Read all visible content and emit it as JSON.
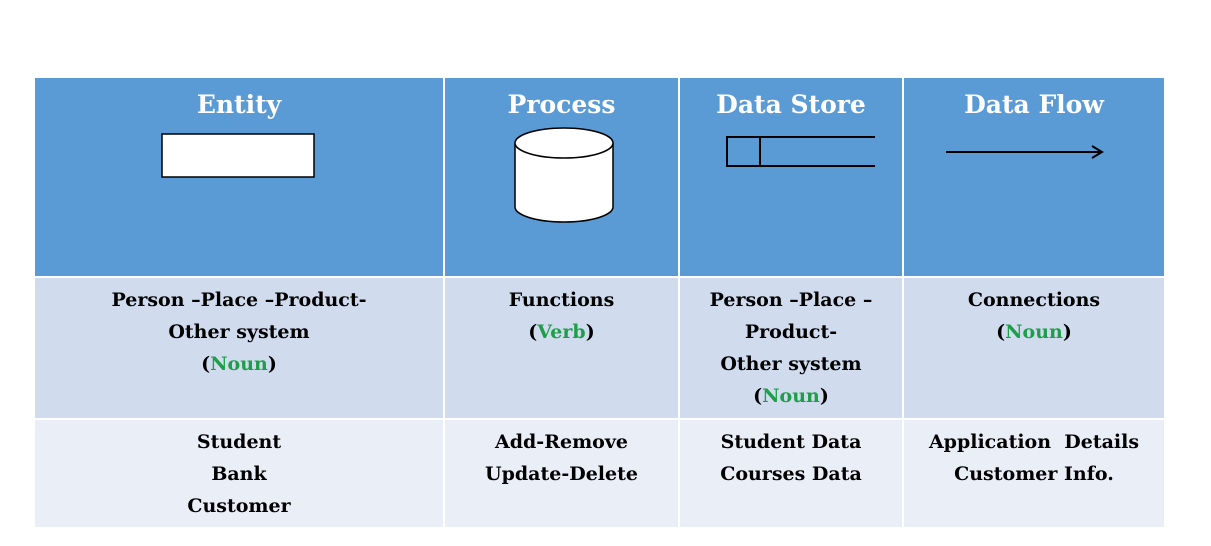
{
  "headers": {
    "entity": "Entity",
    "process": "Process",
    "data_store": "Data Store",
    "data_flow": "Data Flow"
  },
  "descriptions": {
    "entity": {
      "lines": [
        "Person –Place –Product-",
        "Other system"
      ],
      "open": "(",
      "highlight": "Noun",
      "close": ")"
    },
    "process": {
      "lines": [
        "Functions"
      ],
      "open": "(",
      "highlight": "Verb",
      "close": ")"
    },
    "data_store": {
      "lines": [
        "Person –Place –",
        "Product-",
        "Other system"
      ],
      "open": "(",
      "highlight": "Noun",
      "close": ")"
    },
    "data_flow": {
      "lines": [
        "Connections"
      ],
      "open": "(",
      "highlight": "Noun",
      "close": ")"
    }
  },
  "examples": {
    "entity": [
      "Student",
      "Bank",
      "Customer"
    ],
    "process": [
      "Add-Remove",
      "Update-Delete"
    ],
    "data_store": [
      "Student Data",
      "Courses Data"
    ],
    "data_flow": [
      "Application  Details",
      "Customer Info."
    ]
  },
  "colors": {
    "header_bg": "#5b9bd5",
    "desc_bg": "#d0dcee",
    "example_bg": "#e9eef7",
    "highlight": "#1f9e4a"
  },
  "icons": {
    "entity": "rectangle-icon",
    "process": "cylinder-icon",
    "data_store": "open-rectangle-icon",
    "data_flow": "arrow-icon"
  }
}
